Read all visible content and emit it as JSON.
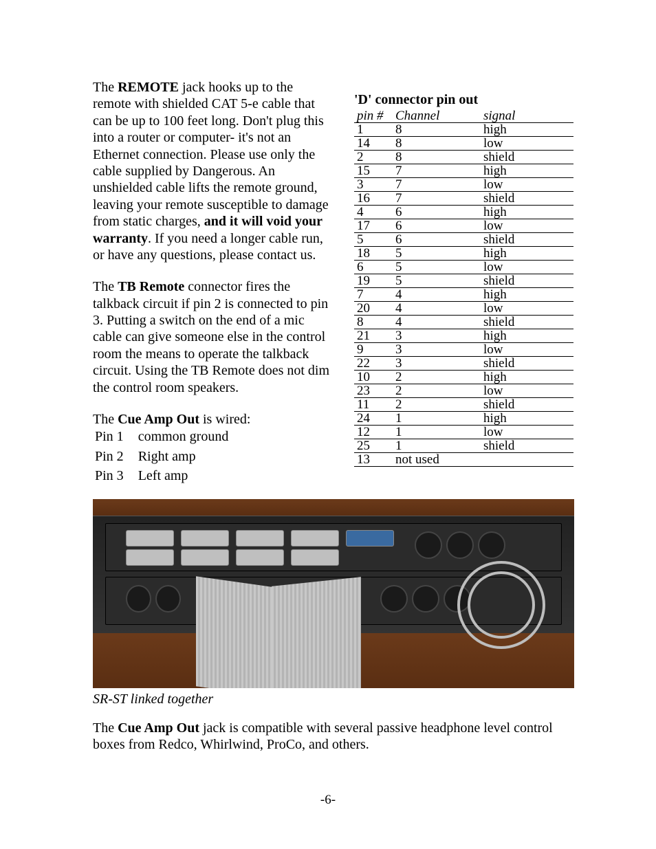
{
  "para1_a": "The ",
  "para1_bold1": "REMOTE",
  "para1_b": " jack hooks up to the remote with shielded CAT 5-e cable that can be up to 100 feet long. Don't plug this into a router or computer- it's not an Ethernet connection. Please use only the cable supplied by Dangerous. An unshielded cable lifts the remote ground, leaving your remote susceptible to damage from static charges, ",
  "para1_bold2": "and it will void your warranty",
  "para1_c": ". If you need a longer cable run, or have any questions, please contact us.",
  "para2_a": "The ",
  "para2_bold": "TB Remote",
  "para2_b": " connector fires the talkback circuit if pin 2 is connected to pin 3. Putting a switch on the end of a mic cable can give someone else in the control room the means to operate the talkback circuit. Using the TB Remote does not dim the control room speakers.",
  "para3_a": "The ",
  "para3_bold": "Cue Amp Out",
  "para3_b": " is wired:",
  "cue": [
    {
      "pin": "Pin 1",
      "desc": "common ground"
    },
    {
      "pin": "Pin 2",
      "desc": "Right amp"
    },
    {
      "pin": "Pin 3",
      "desc": "Left amp"
    }
  ],
  "pinout_title": "'D' connector pin out",
  "pinout_headers": {
    "c1": "pin #",
    "c2": "Channel",
    "c3": "signal"
  },
  "pinout_rows": [
    {
      "pin": "1",
      "ch": "8",
      "sig": "high"
    },
    {
      "pin": "14",
      "ch": "8",
      "sig": "low"
    },
    {
      "pin": "2",
      "ch": "8",
      "sig": "shield"
    },
    {
      "pin": "15",
      "ch": "7",
      "sig": "high"
    },
    {
      "pin": "3",
      "ch": "7",
      "sig": "low"
    },
    {
      "pin": "16",
      "ch": "7",
      "sig": "shield"
    },
    {
      "pin": "4",
      "ch": "6",
      "sig": "high"
    },
    {
      "pin": "17",
      "ch": "6",
      "sig": "low"
    },
    {
      "pin": "5",
      "ch": "6",
      "sig": "shield"
    },
    {
      "pin": "18",
      "ch": "5",
      "sig": "high"
    },
    {
      "pin": "6",
      "ch": "5",
      "sig": "low"
    },
    {
      "pin": "19",
      "ch": "5",
      "sig": "shield"
    },
    {
      "pin": "7",
      "ch": "4",
      "sig": "high"
    },
    {
      "pin": "20",
      "ch": "4",
      "sig": "low"
    },
    {
      "pin": "8",
      "ch": "4",
      "sig": "shield"
    },
    {
      "pin": "21",
      "ch": "3",
      "sig": "high"
    },
    {
      "pin": "9",
      "ch": "3",
      "sig": "low"
    },
    {
      "pin": "22",
      "ch": "3",
      "sig": "shield"
    },
    {
      "pin": "10",
      "ch": "2",
      "sig": "high"
    },
    {
      "pin": "23",
      "ch": "2",
      "sig": "low"
    },
    {
      "pin": "11",
      "ch": "2",
      "sig": "shield"
    },
    {
      "pin": "24",
      "ch": "1",
      "sig": "high"
    },
    {
      "pin": "12",
      "ch": "1",
      "sig": "low"
    },
    {
      "pin": "25",
      "ch": "1",
      "sig": "shield"
    },
    {
      "pin": "13",
      "ch": "not used",
      "sig": ""
    }
  ],
  "caption": "SR-ST linked together",
  "para4_a": "The ",
  "para4_bold": "Cue Amp Out",
  "para4_b": " jack is compatible with several passive headphone level control boxes from Redco, Whirlwind, ProCo, and others.",
  "pagenum": "-6-"
}
